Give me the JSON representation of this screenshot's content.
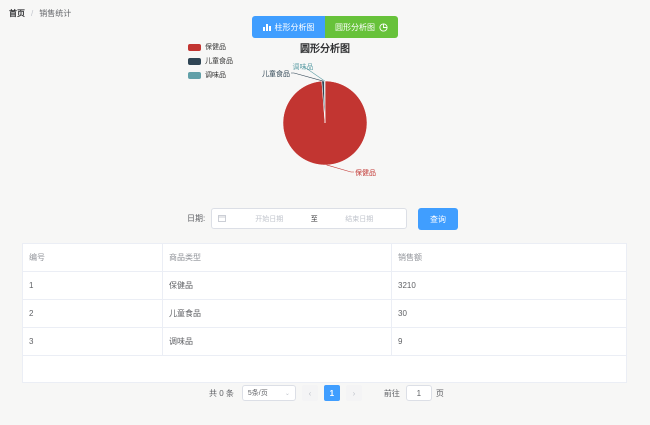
{
  "breadcrumb": {
    "home": "首页",
    "separator": "/",
    "current": "销售统计"
  },
  "toggle": {
    "bar_label": "柱形分析图",
    "pie_label": "圆形分析图"
  },
  "chart_data": {
    "type": "pie",
    "title": "圆形分析图",
    "categories": [
      "保健品",
      "儿童食品",
      "调味品"
    ],
    "values": [
      3210,
      30,
      9
    ],
    "colors": [
      "#c23531",
      "#2f4554",
      "#61a0a8"
    ],
    "legend_position": "top-left"
  },
  "filter": {
    "label": "日期:",
    "start_placeholder": "开始日期",
    "to": "至",
    "end_placeholder": "结束日期",
    "query": "查询"
  },
  "table": {
    "headers": [
      "编号",
      "商品类型",
      "销售额"
    ],
    "rows": [
      [
        "1",
        "保健品",
        "3210"
      ],
      [
        "2",
        "儿童食品",
        "30"
      ],
      [
        "3",
        "调味品",
        "9"
      ]
    ]
  },
  "pagination": {
    "total": "共 0 条",
    "page_size": "5条/页",
    "current_page": "1",
    "goto_label": "前往",
    "goto_value": "1",
    "page_suffix": "页"
  }
}
